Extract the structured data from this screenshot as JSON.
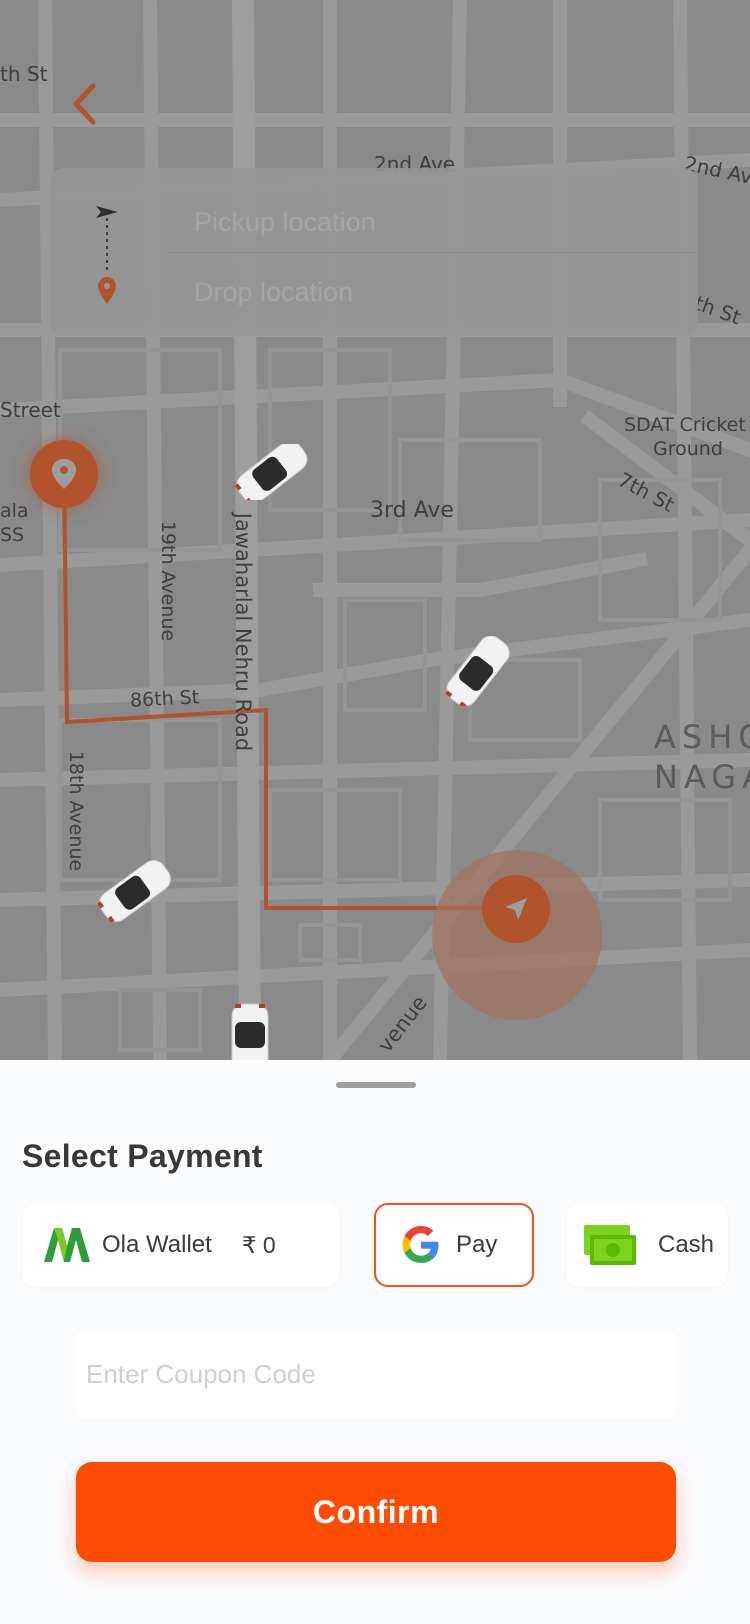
{
  "map": {
    "street_labels": {
      "s9th": "th St",
      "s2nd_ave_top": "2nd Ave",
      "s2nd_ave_right": "2nd Av",
      "s8th_right": "th St",
      "street_left": "Street",
      "sdat_1": "SDAT Cricket",
      "sdat_2": "Ground",
      "s7th": "7th St",
      "s3rd_ave": "3rd Ave",
      "ala": "ala",
      "ss": "SS",
      "s19th": "19th Avenue",
      "jawaharlal": "Jawaharlal Nehru Road",
      "s86th": "86th St",
      "s18th": "18th Avenue",
      "ashok1": "ASHO",
      "ashok2": "NAGA",
      "avenue_bottom": "venue"
    },
    "pickup_placeholder": "Pickup location",
    "drop_placeholder": "Drop location",
    "route_color": "#b1532d"
  },
  "sheet": {
    "title": "Select Payment",
    "payment_options": [
      {
        "label": "Ola Wallet",
        "balance": "₹ 0",
        "icon": "ola-wallet-icon"
      },
      {
        "label": "Pay",
        "icon": "google-g-icon",
        "selected": true
      },
      {
        "label": "Cash",
        "icon": "cash-icon"
      }
    ],
    "coupon_placeholder": "Enter Coupon Code",
    "confirm_label": "Confirm",
    "accent_color": "#ff4c05"
  }
}
